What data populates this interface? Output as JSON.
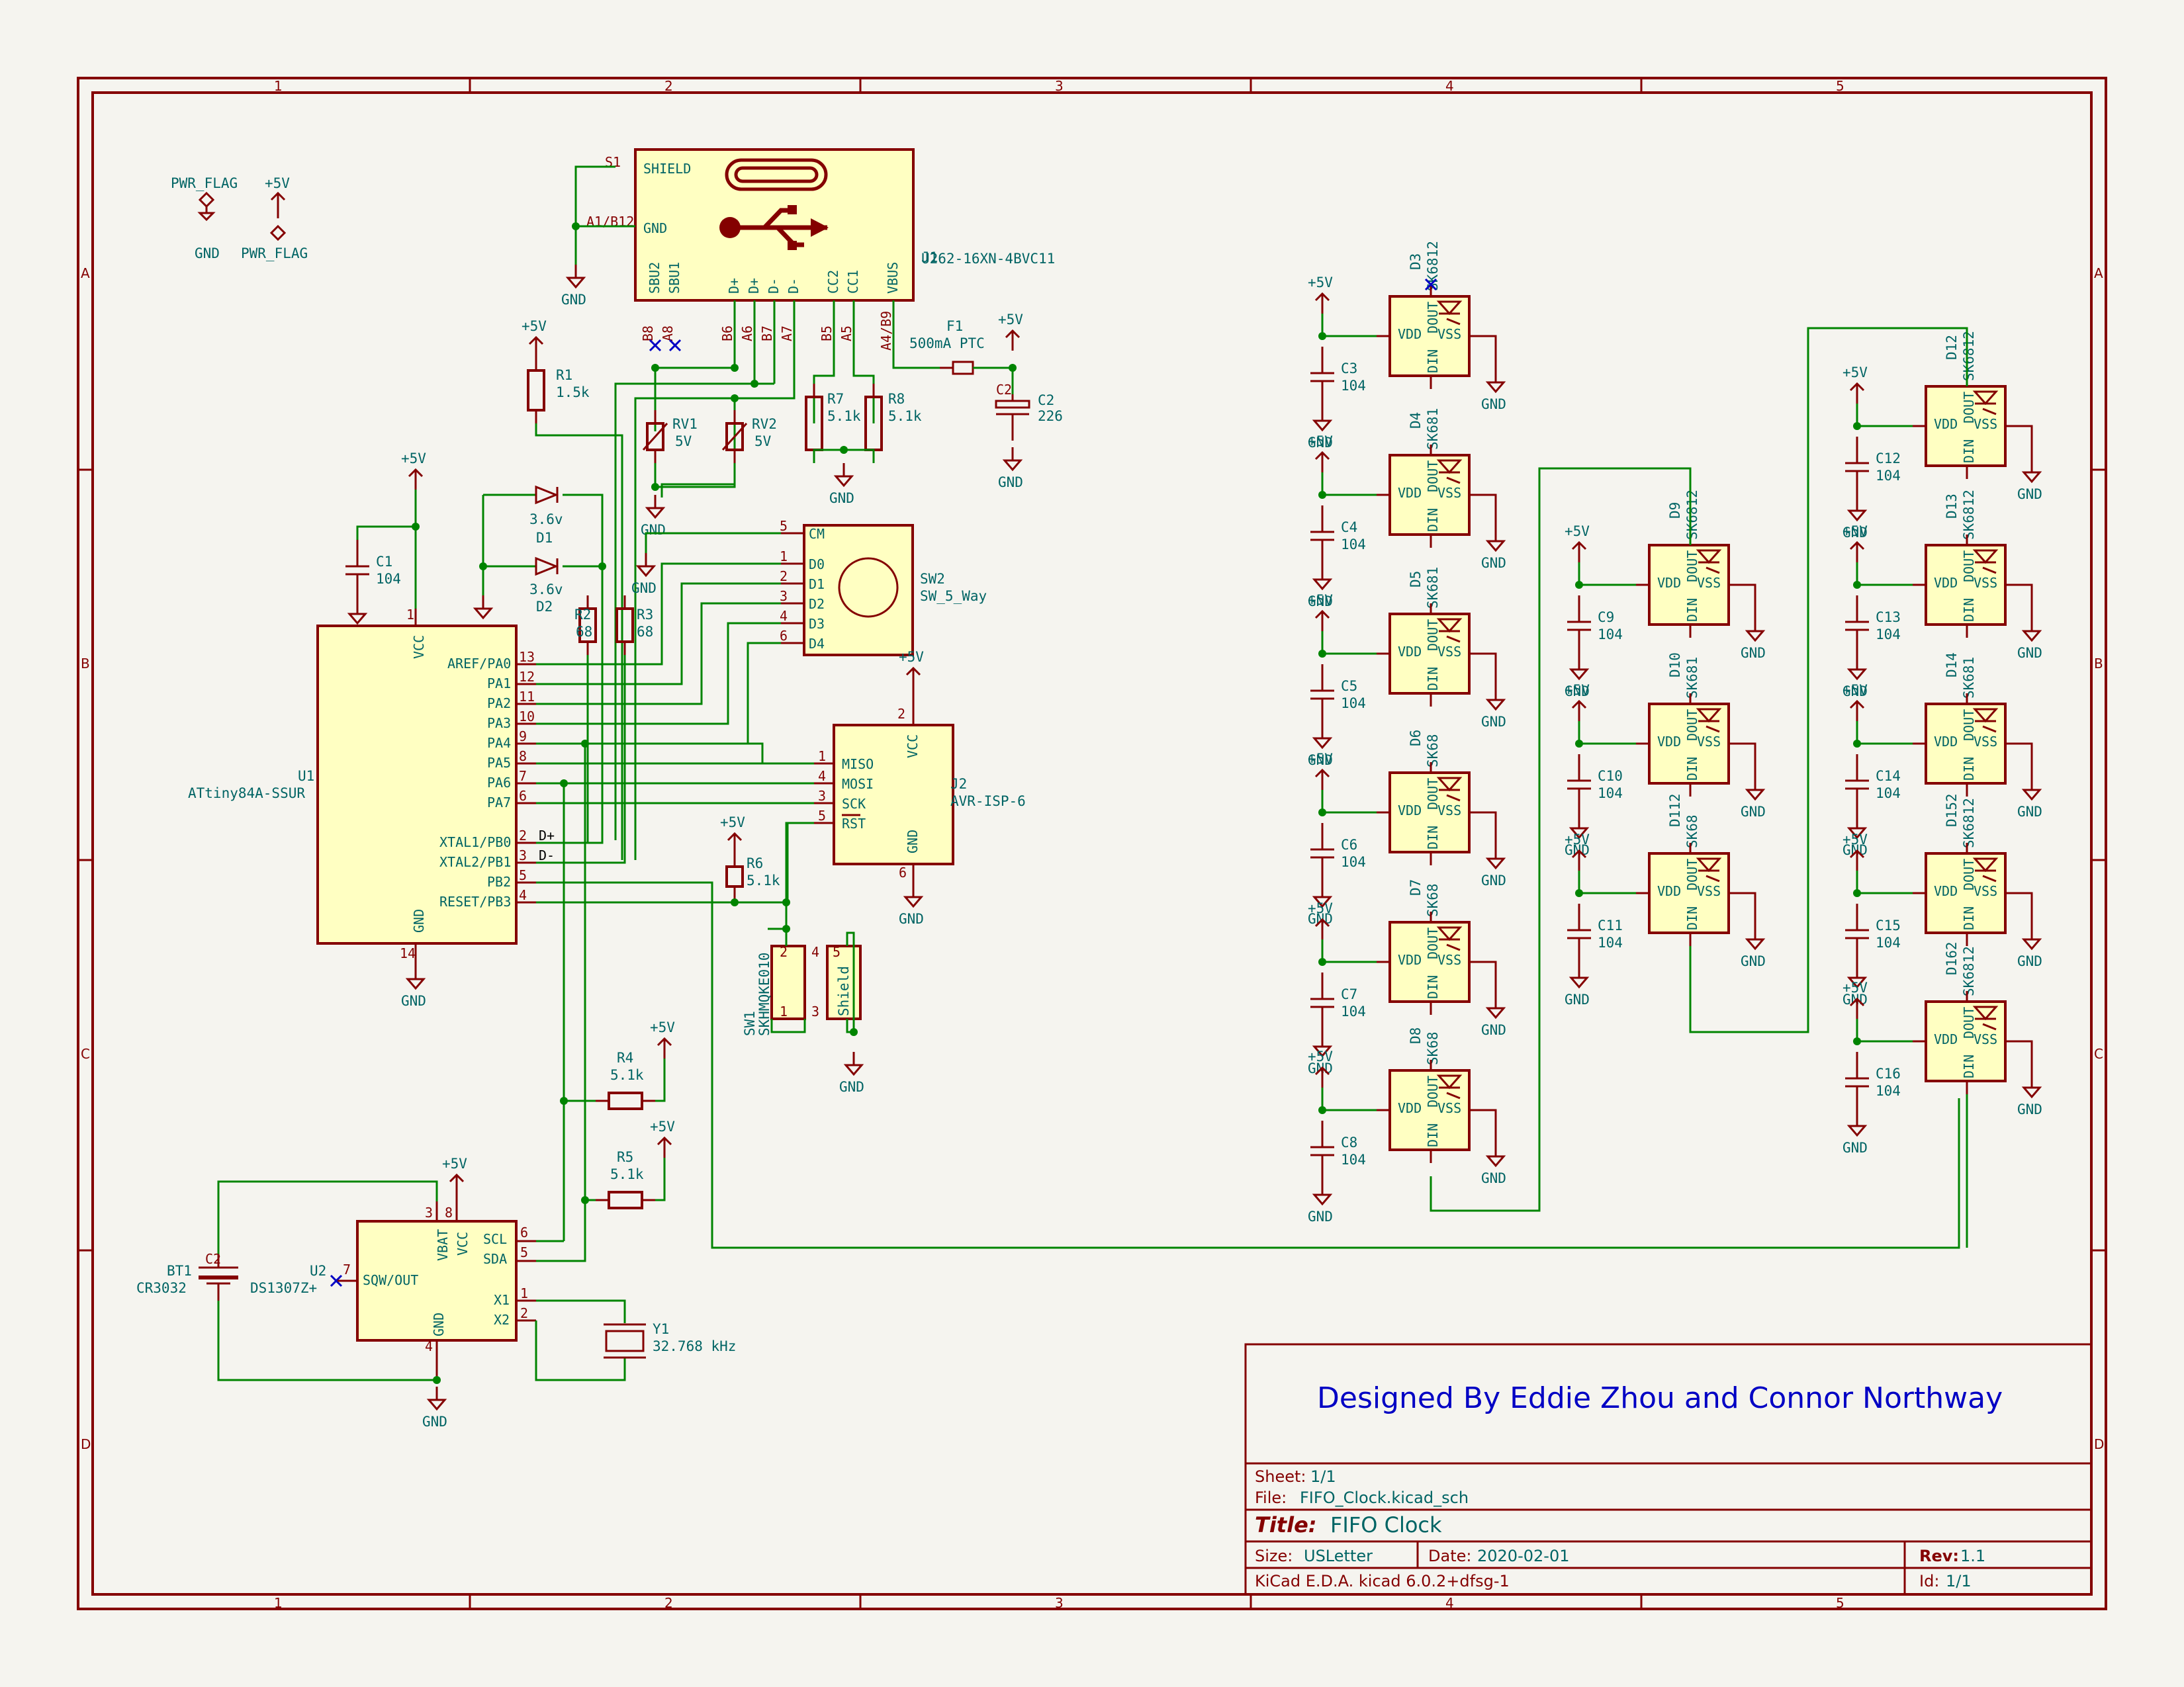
{
  "title_block": {
    "designed_by": "Designed By Eddie Zhou and Connor Northway",
    "sheet_label": "Sheet:",
    "sheet_value": "1/1",
    "file_label": "File:",
    "file_value": "FIFO_Clock.kicad_sch",
    "title_label": "Title:",
    "title_value": "FIFO Clock",
    "size_label": "Size:",
    "size_value": "USLetter",
    "date_label": "Date:",
    "date_value": "2020-02-01",
    "rev_label": "Rev:",
    "rev_value": "1.1",
    "tool": "KiCad E.D.A.  kicad 6.0.2+dfsg-1",
    "id_label": "Id:",
    "id_value": "1/1"
  },
  "grid": {
    "columns": [
      "1",
      "2",
      "3",
      "4",
      "5"
    ],
    "rows": [
      "A",
      "B",
      "C",
      "D"
    ]
  },
  "power": {
    "pwr_flag": "PWR_FLAG",
    "plus5v": "+5V",
    "gnd": "GND"
  },
  "usb": {
    "ref": "J1",
    "value": "U262-16XN-4BVC11",
    "pins": {
      "shield": "SHIELD",
      "gnd": "GND",
      "sbu2": "SBU2",
      "sbu1": "SBU1",
      "dp1": "D+",
      "dp2": "D+",
      "dm1": "D-",
      "dm2": "D-",
      "cc2": "CC2",
      "cc1": "CC1",
      "vbus": "VBUS"
    },
    "pin_numbers": {
      "s1": "S1",
      "a1b12": "A1/B12",
      "b8": "B8",
      "a8": "A8",
      "b6": "B6",
      "a6": "A6",
      "b7": "B7",
      "a7": "A7",
      "b5": "B5",
      "a5": "A5",
      "a4b9": "A4/B9"
    }
  },
  "fuse": {
    "ref": "F1",
    "value": "500mA PTC"
  },
  "c2": {
    "ref": "C2",
    "value": "226"
  },
  "r1": {
    "ref": "R1",
    "value": "1.5k"
  },
  "rv1": {
    "ref": "RV1",
    "value": "5V"
  },
  "rv2": {
    "ref": "RV2",
    "value": "5V"
  },
  "r7": {
    "ref": "R7",
    "value": "5.1k"
  },
  "r8": {
    "ref": "R8",
    "value": "5.1k"
  },
  "d1": {
    "ref": "D1",
    "value": "3.6v"
  },
  "d2": {
    "ref": "D2",
    "value": "3.6v"
  },
  "c1": {
    "ref": "C1",
    "value": "104"
  },
  "r2": {
    "ref": "R2",
    "value": "68"
  },
  "r3": {
    "ref": "R3",
    "value": "68"
  },
  "sw2": {
    "ref": "SW2",
    "value": "SW_5_Way",
    "pins": [
      "CM",
      "D0",
      "D1",
      "D2",
      "D3",
      "D4"
    ],
    "pin_numbers": [
      "5",
      "1",
      "2",
      "3",
      "4",
      "6"
    ]
  },
  "u1": {
    "ref": "U1",
    "value": "ATtiny84A-SSUR",
    "vcc": "VCC",
    "gnd": "GND",
    "vcc_pin": "1",
    "gnd_pin": "14",
    "pins": [
      {
        "name": "AREF/PA0",
        "num": "13"
      },
      {
        "name": "PA1",
        "num": "12"
      },
      {
        "name": "PA2",
        "num": "11"
      },
      {
        "name": "PA3",
        "num": "10"
      },
      {
        "name": "PA4",
        "num": "9"
      },
      {
        "name": "PA5",
        "num": "8"
      },
      {
        "name": "PA6",
        "num": "7"
      },
      {
        "name": "PA7",
        "num": "6"
      },
      {
        "name": "XTAL1/PB0",
        "num": "2"
      },
      {
        "name": "XTAL2/PB1",
        "num": "3"
      },
      {
        "name": "PB2",
        "num": "5"
      },
      {
        "name": "RESET/PB3",
        "num": "4"
      }
    ],
    "net_dp": "D+",
    "net_dm": "D-"
  },
  "j2": {
    "ref": "J2",
    "value": "AVR-ISP-6",
    "vcc": "VCC",
    "gnd": "GND",
    "vcc_pin": "2",
    "gnd_pin": "6",
    "pins": [
      {
        "name": "MISO",
        "num": "1"
      },
      {
        "name": "MOSI",
        "num": "4"
      },
      {
        "name": "SCK",
        "num": "3"
      },
      {
        "name": "RST",
        "num": "5"
      }
    ]
  },
  "r6": {
    "ref": "R6",
    "value": "5.1k"
  },
  "sw1": {
    "ref": "SW1",
    "value": "SKHMQKE010",
    "shield": "Shield",
    "pins": [
      "2",
      "1",
      "4",
      "3",
      "5"
    ]
  },
  "r4": {
    "ref": "R4",
    "value": "5.1k"
  },
  "r5": {
    "ref": "R5",
    "value": "5.1k"
  },
  "u2": {
    "ref": "U2",
    "value": "DS1307Z+",
    "vbat": "VBAT",
    "vcc": "VCC",
    "scl": "SCL",
    "sda": "SDA",
    "sqw": "SQW/OUT",
    "gnd": "GND",
    "x1": "X1",
    "x2": "X2",
    "pins": {
      "vbat": "3",
      "vcc": "8",
      "scl": "6",
      "sda": "5",
      "sqw": "7",
      "gnd": "4",
      "x1": "1",
      "x2": "2"
    }
  },
  "bt1": {
    "ref": "BT1",
    "value": "CR3032"
  },
  "y1": {
    "ref": "Y1",
    "value": "32.768 kHz"
  },
  "led_pins": {
    "vdd": "VDD",
    "vss": "VSS",
    "din": "DIN",
    "dout": "DOUT"
  },
  "leds": [
    {
      "ref": "D3",
      "value": "SK6812"
    },
    {
      "ref": "D4",
      "value": "SK681"
    },
    {
      "ref": "D5",
      "value": "SK681"
    },
    {
      "ref": "D6",
      "value": "SK68"
    },
    {
      "ref": "D7",
      "value": "SK68"
    },
    {
      "ref": "D8",
      "value": "SK68"
    },
    {
      "ref": "D9",
      "value": "SK6812"
    },
    {
      "ref": "D10",
      "value": "SK681"
    },
    {
      "ref": "D112",
      "value": "SK68"
    },
    {
      "ref": "D12",
      "value": "SK6812"
    },
    {
      "ref": "D13",
      "value": "SK6812"
    },
    {
      "ref": "D14",
      "value": "SK681"
    },
    {
      "ref": "D152",
      "value": "SK6812"
    },
    {
      "ref": "D162",
      "value": "SK6812"
    }
  ],
  "led_caps": [
    {
      "ref": "C3",
      "value": "104"
    },
    {
      "ref": "C4",
      "value": "104"
    },
    {
      "ref": "C5",
      "value": "104"
    },
    {
      "ref": "C6",
      "value": "104"
    },
    {
      "ref": "C7",
      "value": "104"
    },
    {
      "ref": "C8",
      "value": "104"
    },
    {
      "ref": "C9",
      "value": "104"
    },
    {
      "ref": "C10",
      "value": "104"
    },
    {
      "ref": "C11",
      "value": "104"
    },
    {
      "ref": "C12",
      "value": "104"
    },
    {
      "ref": "C13",
      "value": "104"
    },
    {
      "ref": "C14",
      "value": "104"
    },
    {
      "ref": "C15",
      "value": "104"
    },
    {
      "ref": "C16",
      "value": "104"
    }
  ]
}
